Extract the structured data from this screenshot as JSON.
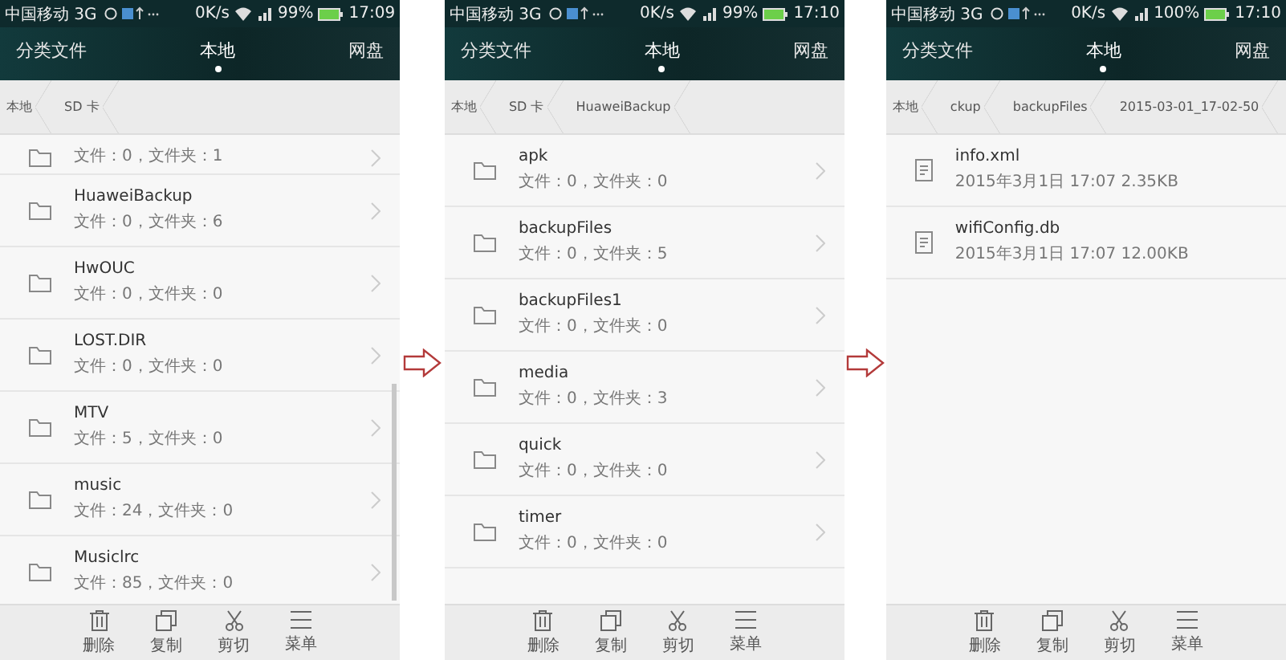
{
  "phones": [
    {
      "status": {
        "carrier": "中国移动 3G",
        "speed": "0K/s",
        "battery": "99%",
        "time": "17:09"
      },
      "tabs": [
        {
          "label": "分类文件",
          "selected": false
        },
        {
          "label": "本地",
          "selected": true
        },
        {
          "label": "网盘",
          "selected": false
        }
      ],
      "breadcrumb": [
        "本地",
        "SD 卡"
      ],
      "scrollbar": true,
      "items": [
        {
          "kind": "folder",
          "info": "文件：0，文件夹：1"
        },
        {
          "kind": "folder",
          "name": "HuaweiBackup",
          "info": "文件：0，文件夹：6"
        },
        {
          "kind": "folder",
          "name": "HwOUC",
          "info": "文件：0，文件夹：0"
        },
        {
          "kind": "folder",
          "name": "LOST.DIR",
          "info": "文件：0，文件夹：0"
        },
        {
          "kind": "folder",
          "name": "MTV",
          "info": "文件：5，文件夹：0"
        },
        {
          "kind": "folder",
          "name": "music",
          "info": "文件：24，文件夹：0"
        },
        {
          "kind": "folder",
          "name": "Musiclrc",
          "info": "文件：85，文件夹：0"
        }
      ],
      "toolbar": [
        {
          "kind": "delete",
          "label": "删除"
        },
        {
          "kind": "copy",
          "label": "复制"
        },
        {
          "kind": "cut",
          "label": "剪切"
        },
        {
          "kind": "menu",
          "label": "菜单"
        }
      ]
    },
    {
      "status": {
        "carrier": "中国移动 3G",
        "speed": "0K/s",
        "battery": "99%",
        "time": "17:10"
      },
      "tabs": [
        {
          "label": "分类文件",
          "selected": false
        },
        {
          "label": "本地",
          "selected": true
        },
        {
          "label": "网盘",
          "selected": false
        }
      ],
      "breadcrumb": [
        "本地",
        "SD 卡",
        "HuaweiBackup"
      ],
      "items": [
        {
          "kind": "folder",
          "name": "apk",
          "info": "文件：0，文件夹：0"
        },
        {
          "kind": "folder",
          "name": "backupFiles",
          "info": "文件：0，文件夹：5"
        },
        {
          "kind": "folder",
          "name": "backupFiles1",
          "info": "文件：0，文件夹：0"
        },
        {
          "kind": "folder",
          "name": "media",
          "info": "文件：0，文件夹：3"
        },
        {
          "kind": "folder",
          "name": "quick",
          "info": "文件：0，文件夹：0"
        },
        {
          "kind": "folder",
          "name": "timer",
          "info": "文件：0，文件夹：0"
        }
      ],
      "toolbar": [
        {
          "kind": "delete",
          "label": "删除"
        },
        {
          "kind": "copy",
          "label": "复制"
        },
        {
          "kind": "cut",
          "label": "剪切"
        },
        {
          "kind": "menu",
          "label": "菜单"
        }
      ]
    },
    {
      "status": {
        "carrier": "中国移动 3G",
        "speed": "0K/s",
        "battery": "100%",
        "time": "17:10"
      },
      "tabs": [
        {
          "label": "分类文件",
          "selected": false
        },
        {
          "label": "本地",
          "selected": true
        },
        {
          "label": "网盘",
          "selected": false
        }
      ],
      "breadcrumb": [
        "本地",
        "ckup",
        "backupFiles",
        "2015-03-01_17-02-50"
      ],
      "items": [
        {
          "kind": "file",
          "name": "info.xml",
          "info": "2015年3月1日 17:07 2.35KB"
        },
        {
          "kind": "file",
          "name": "wifiConfig.db",
          "info": "2015年3月1日 17:07 12.00KB"
        }
      ],
      "toolbar": [
        {
          "kind": "delete",
          "label": "删除"
        },
        {
          "kind": "copy",
          "label": "复制"
        },
        {
          "kind": "cut",
          "label": "剪切"
        },
        {
          "kind": "menu",
          "label": "菜单"
        }
      ]
    }
  ]
}
